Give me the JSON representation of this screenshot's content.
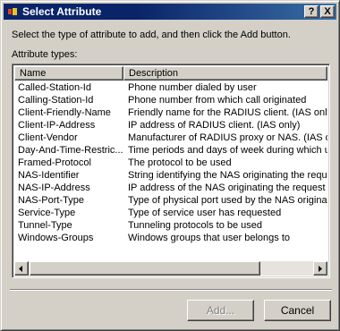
{
  "window": {
    "title": "Select Attribute",
    "help_label": "?",
    "close_label": "X"
  },
  "instruction": "Select the type of attribute to add, and then click the Add button.",
  "types_label": "Attribute types:",
  "columns": [
    "Name",
    "Description"
  ],
  "rows": [
    {
      "name": "Called-Station-Id",
      "desc": "Phone number dialed by user"
    },
    {
      "name": "Calling-Station-Id",
      "desc": "Phone number from which call originated"
    },
    {
      "name": "Client-Friendly-Name",
      "desc": "Friendly name for the RADIUS client. (IAS only)"
    },
    {
      "name": "Client-IP-Address",
      "desc": "IP address of RADIUS client. (IAS only)"
    },
    {
      "name": "Client-Vendor",
      "desc": "Manufacturer of RADIUS proxy or NAS. (IAS onl"
    },
    {
      "name": "Day-And-Time-Restric...",
      "desc": "Time periods and days of week during which use"
    },
    {
      "name": "Framed-Protocol",
      "desc": "The protocol to be used"
    },
    {
      "name": "NAS-Identifier",
      "desc": "String identifying the NAS originating the request"
    },
    {
      "name": "NAS-IP-Address",
      "desc": "IP address of the NAS originating the request (IA"
    },
    {
      "name": "NAS-Port-Type",
      "desc": "Type of physical port used by the NAS originatin"
    },
    {
      "name": "Service-Type",
      "desc": "Type of service user has requested"
    },
    {
      "name": "Tunnel-Type",
      "desc": "Tunneling protocols to be used"
    },
    {
      "name": "Windows-Groups",
      "desc": "Windows groups that user belongs to"
    }
  ],
  "buttons": {
    "add": "Add...",
    "cancel": "Cancel"
  },
  "colors": {
    "titlebar": "#0a246a",
    "face": "#d4d0c8"
  }
}
